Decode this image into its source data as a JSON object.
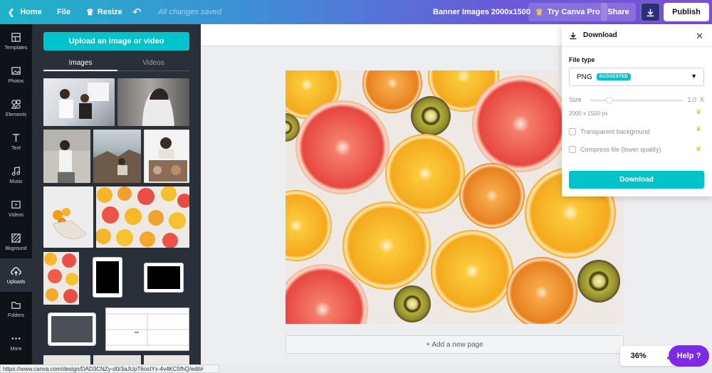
{
  "topbar": {
    "home_label": "Home",
    "file_label": "File",
    "resize_label": "Resize",
    "saved_status": "All changes saved",
    "document_title": "Banner Images 2000x1500",
    "pro_label": "Try Canva Pro",
    "share_label": "Share",
    "publish_label": "Publish"
  },
  "nav": {
    "items": [
      {
        "label": "Templates",
        "icon": "templates-icon"
      },
      {
        "label": "Photos",
        "icon": "photos-icon"
      },
      {
        "label": "Elements",
        "icon": "elements-icon"
      },
      {
        "label": "Text",
        "icon": "text-icon"
      },
      {
        "label": "Music",
        "icon": "music-icon"
      },
      {
        "label": "Videos",
        "icon": "videos-icon"
      },
      {
        "label": "Bkground",
        "icon": "background-icon"
      },
      {
        "label": "Uploads",
        "icon": "uploads-icon",
        "active": true
      },
      {
        "label": "Folders",
        "icon": "folders-icon"
      },
      {
        "label": "More",
        "icon": "more-icon"
      }
    ]
  },
  "panel": {
    "upload_button": "Upload an image or video",
    "tabs": [
      "Images",
      "Videos"
    ],
    "active_tab": "Images"
  },
  "canvas": {
    "add_page_label": "+ Add a new page",
    "zoom_level": "36%",
    "help_label": "Help ?"
  },
  "download_panel": {
    "title": "Download",
    "file_type_label": "File type",
    "file_type_value": "PNG",
    "suggested_badge": "SUGGESTED",
    "size_label": "Size",
    "size_value": "1.0",
    "size_unit": "X",
    "dimensions": "2000 x 1500 px",
    "transparent_label": "Transparent background",
    "compress_label": "Compress file (lower quality)",
    "download_button": "Download"
  },
  "statusbar": {
    "url": "https://www.canva.com/design/DAD3CNZy-d0/3aJUpT6osIYx-4v4KC5fhQ/edit#"
  },
  "colors": {
    "accent": "#00c4cc",
    "help": "#7d2ae8",
    "sidebar": "#0e1318",
    "panel": "#293039"
  }
}
